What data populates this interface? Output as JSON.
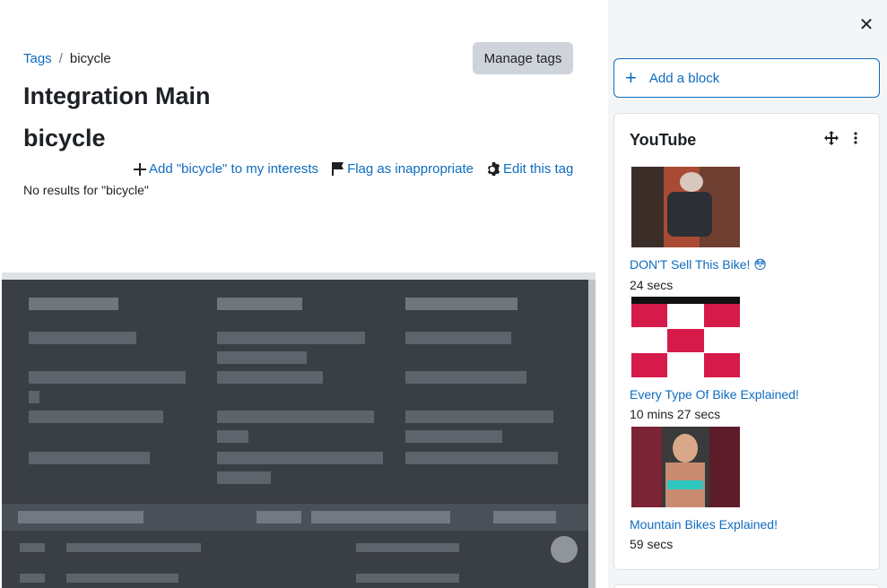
{
  "breadcrumb": {
    "root": "Tags",
    "separator": "/",
    "current": "bicycle"
  },
  "manage_tags_label": "Manage tags",
  "page_title": "Integration Main",
  "tag_name": "bicycle",
  "tag_actions": {
    "add_interest": "Add \"bicycle\" to my interests",
    "flag": "Flag as inappropriate",
    "edit": "Edit this tag"
  },
  "no_results": "No results for \"bicycle\"",
  "drawer": {
    "close_glyph": "✕",
    "add_block_label": "Add a block",
    "youtube": {
      "title": "YouTube",
      "videos": [
        {
          "title": "DON'T Sell This Bike! 😳",
          "duration": "24 secs"
        },
        {
          "title": "Every Type Of Bike Explained!",
          "duration": "10 mins 27 secs"
        },
        {
          "title": "Mountain Bikes Explained!",
          "duration": "59 secs"
        }
      ]
    }
  },
  "colors": {
    "link": "#0f6cbf",
    "button_bg": "#ced4da",
    "drawer_bg": "#f4f5f7",
    "text": "#1d2125"
  }
}
